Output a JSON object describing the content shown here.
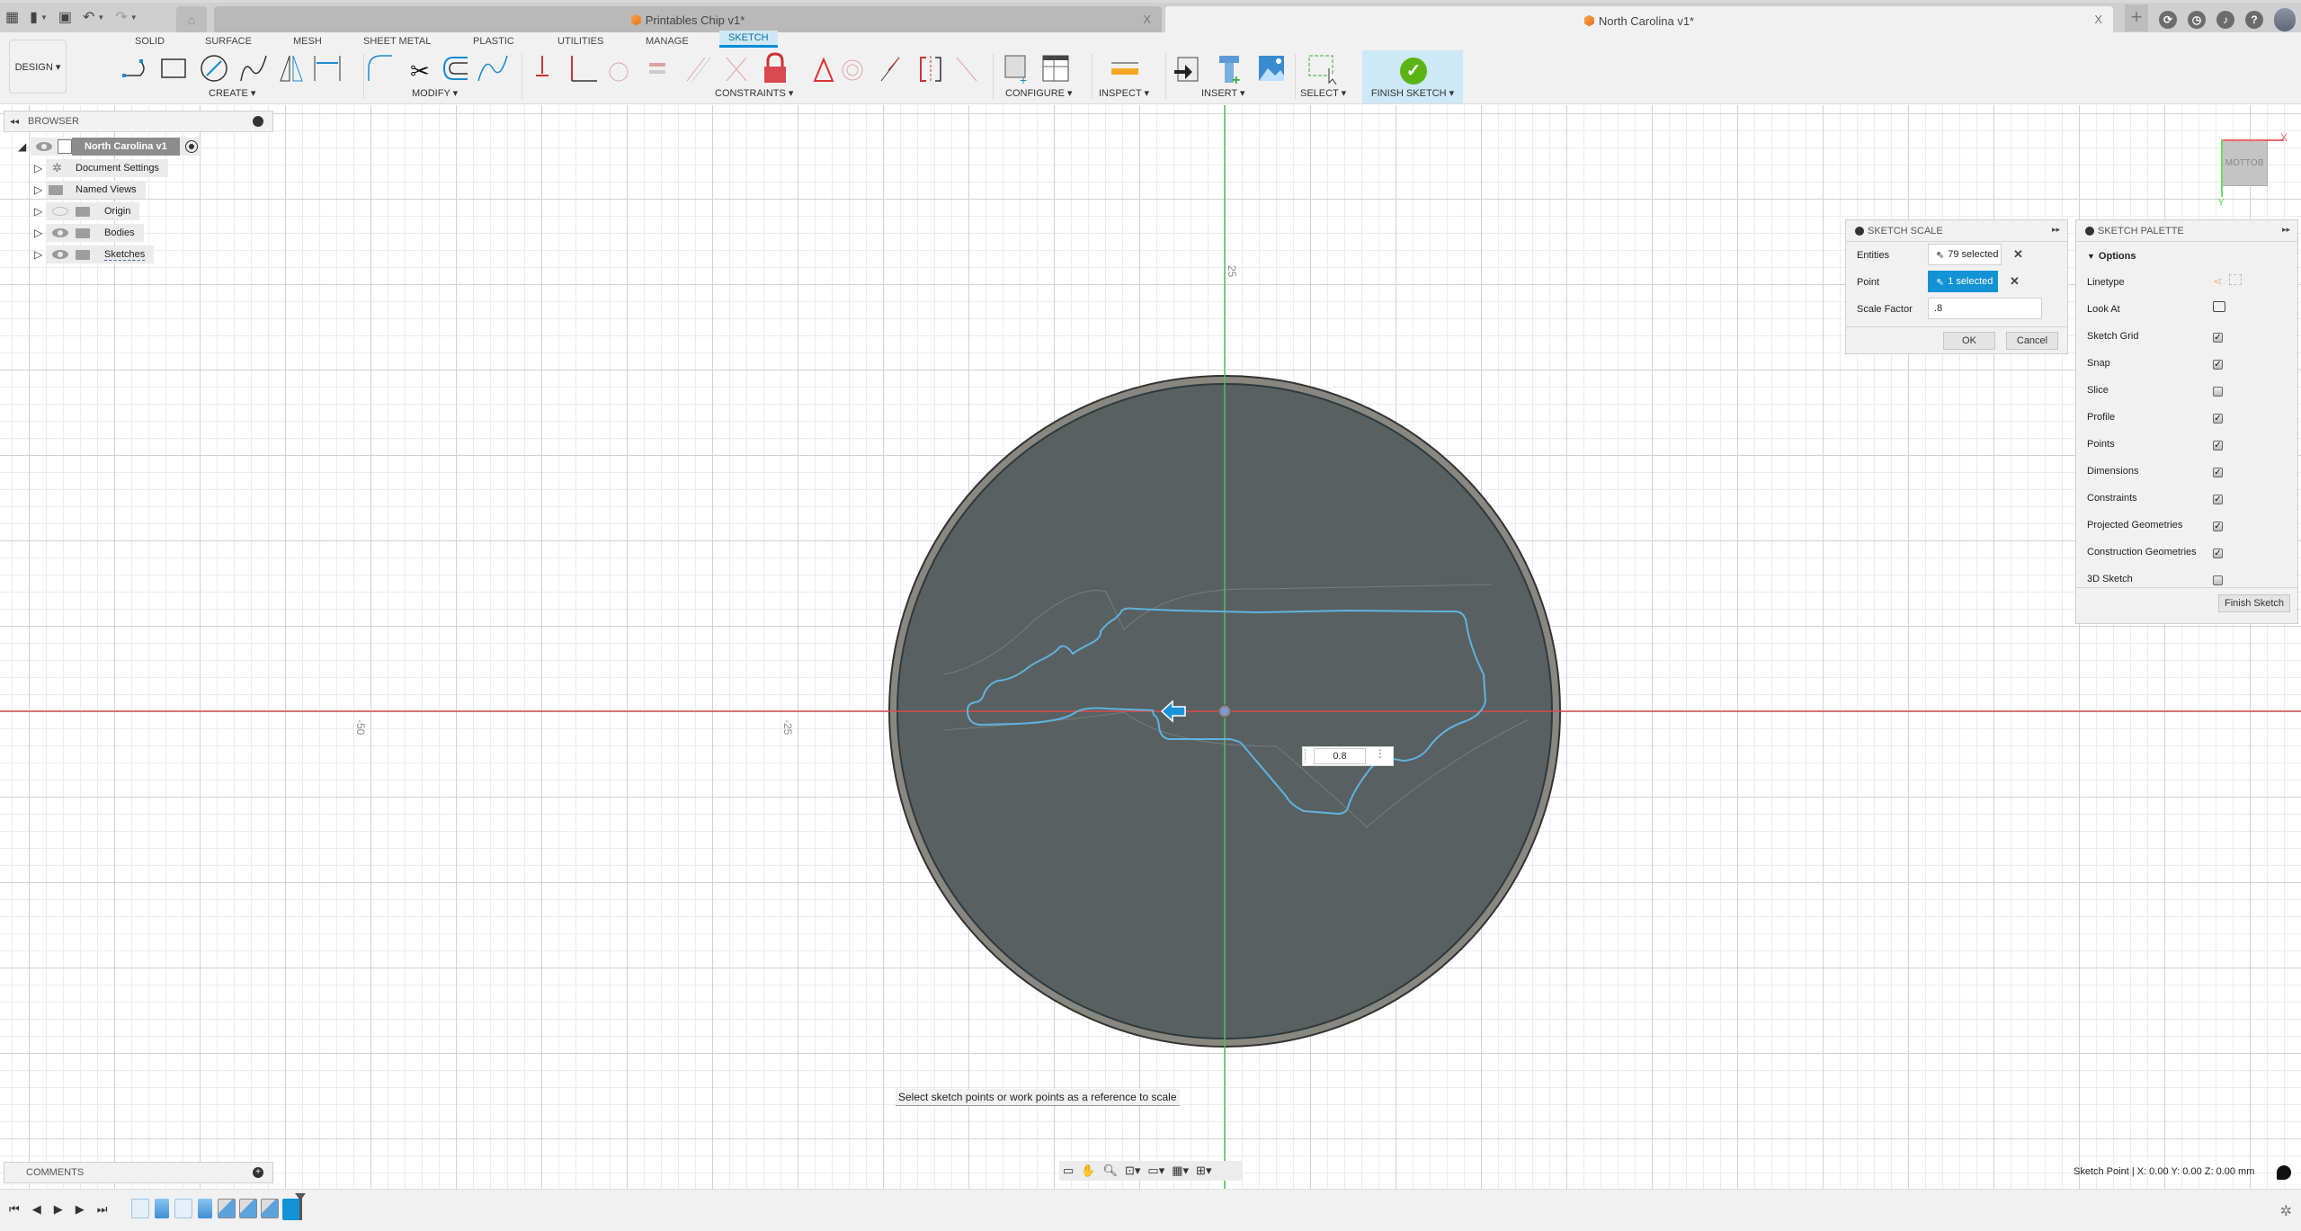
{
  "titlebar": {
    "inactive_tab": "Printables Chip v1*",
    "active_tab": "North Carolina v1*",
    "close_glyph": "X",
    "quick_access": [
      "grid-menu-icon",
      "file-icon",
      "save-icon",
      "undo-icon",
      "redo-icon"
    ],
    "right_icons": [
      "new-tab-icon",
      "extensions-icon",
      "job-status-icon",
      "notifications-icon",
      "help-icon",
      "profile-avatar"
    ]
  },
  "ribbon": {
    "workspace": "DESIGN ▾",
    "tabs": [
      "SOLID",
      "SURFACE",
      "MESH",
      "SHEET METAL",
      "PLASTIC",
      "UTILITIES",
      "MANAGE",
      "SKETCH"
    ],
    "active_tab": "SKETCH",
    "groups": {
      "create": "CREATE ▾",
      "modify": "MODIFY ▾",
      "constraints": "CONSTRAINTS ▾",
      "configure": "CONFIGURE ▾",
      "inspect": "INSPECT ▾",
      "insert": "INSERT ▾",
      "select": "SELECT ▾",
      "finish": "FINISH SKETCH ▾"
    }
  },
  "browser": {
    "title": "BROWSER",
    "root": "North Carolina v1",
    "items": [
      {
        "label": "Document Settings",
        "icon": "gear-icon",
        "visible": null
      },
      {
        "label": "Named Views",
        "icon": "folder-icon",
        "visible": null
      },
      {
        "label": "Origin",
        "icon": "folder-icon",
        "visible": false
      },
      {
        "label": "Bodies",
        "icon": "folder-icon",
        "visible": true
      },
      {
        "label": "Sketches",
        "icon": "folder-icon",
        "visible": true
      }
    ]
  },
  "canvas": {
    "axis_labels": {
      "x_minus_50": "-50",
      "x_minus_25": "-25",
      "y_25": "25"
    },
    "scale_input_value": "0.8",
    "viewcube_face": "BOTTOM",
    "viewcube_x": "X",
    "viewcube_y": "Y",
    "colors": {
      "sketch_profile": "#5fb3e0",
      "x_axis": "#d94a4a",
      "y_axis": "#4cc24c",
      "disc": "#596061"
    }
  },
  "sketch_scale": {
    "title": "SKETCH SCALE",
    "entities_label": "Entities",
    "entities_value": "79 selected",
    "point_label": "Point",
    "point_value": "1 selected",
    "scale_factor_label": "Scale Factor",
    "scale_factor_value": ".8",
    "ok": "OK",
    "cancel": "Cancel"
  },
  "sketch_palette": {
    "title": "SKETCH PALETTE",
    "section": "Options",
    "linetype_label": "Linetype",
    "look_at_label": "Look At",
    "options": [
      {
        "label": "Sketch Grid",
        "checked": true
      },
      {
        "label": "Snap",
        "checked": true
      },
      {
        "label": "Slice",
        "checked": false
      },
      {
        "label": "Profile",
        "checked": true
      },
      {
        "label": "Points",
        "checked": true
      },
      {
        "label": "Dimensions",
        "checked": true
      },
      {
        "label": "Constraints",
        "checked": true
      },
      {
        "label": "Projected Geometries",
        "checked": true
      },
      {
        "label": "Construction Geometries",
        "checked": true
      },
      {
        "label": "3D Sketch",
        "checked": false
      }
    ],
    "finish_button": "Finish Sketch"
  },
  "prompt": "Select sketch points or work points as a reference to scale",
  "comments": {
    "title": "COMMENTS"
  },
  "status": "Sketch Point | X: 0.00 Y: 0.00 Z: 0.00 mm",
  "timeline": {
    "controls": [
      "go-to-start",
      "step-back",
      "play",
      "step-forward",
      "go-to-end"
    ],
    "features": [
      "sketch",
      "extrude",
      "sketch",
      "extrude",
      "fillet",
      "fillet",
      "chamfer",
      "sketch-current"
    ]
  }
}
